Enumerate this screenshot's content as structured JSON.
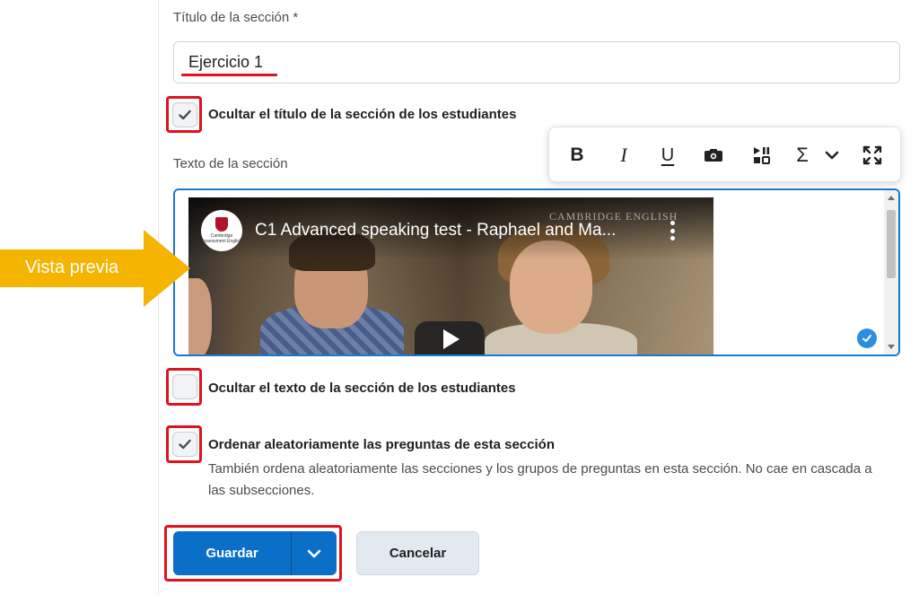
{
  "section_title": {
    "label": "Título de la sección *",
    "value": "Ejercicio 1"
  },
  "hide_title": {
    "checked": true,
    "label": "Ocultar el título de la sección de los estudiantes"
  },
  "section_text": {
    "label": "Texto de la sección"
  },
  "toolbar": {
    "bold": "B",
    "italic": "I",
    "underline": "U",
    "sum": "Σ",
    "icons": [
      "bold-icon",
      "italic-icon",
      "underline-icon",
      "insert-image-icon",
      "insert-media-icon",
      "equation-icon",
      "chevron-down-icon",
      "fullscreen-icon"
    ]
  },
  "video": {
    "title": "C1 Advanced speaking test - Raphael and Ma...",
    "brand": "CAMBRIDGE ENGLISH",
    "logo_text": "Cambridge Assessment English"
  },
  "callout": {
    "text": "Vista previa",
    "color": "#f5b400"
  },
  "hide_text": {
    "checked": false,
    "label": "Ocultar el texto de la sección de los estudiantes"
  },
  "randomize": {
    "checked": true,
    "label": "Ordenar aleatoriamente las preguntas de esta sección",
    "description": "También ordena aleatoriamente las secciones y los grupos de preguntas en esta sección. No cae en cascada a las subsecciones."
  },
  "buttons": {
    "save": "Guardar",
    "cancel": "Cancelar"
  },
  "colors": {
    "highlight": "#e0121f",
    "primary": "#0b6fc7",
    "focus": "#1e78c8"
  }
}
